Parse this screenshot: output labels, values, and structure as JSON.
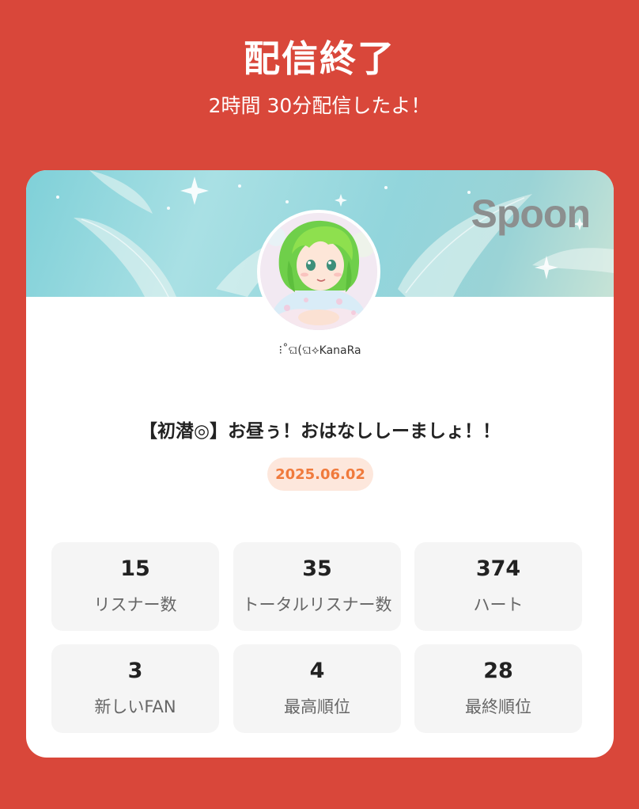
{
  "header": {
    "title": "配信終了",
    "subtitle": "2時間 30分配信したよ！"
  },
  "card": {
    "brand": "Spoon",
    "username_deco": "⁝˚ଘ(ଘ⟡",
    "username": "KanaRa",
    "broadcast_title": "【初潜◎】お昼ぅ！おはなししーましょ！！",
    "date": "2025.06.02",
    "accent_color": "#d9473a",
    "date_color": "#f07a3c"
  },
  "stats": [
    {
      "value": "15",
      "label": "リスナー数"
    },
    {
      "value": "35",
      "label": "トータルリスナー数"
    },
    {
      "value": "374",
      "label": "ハート"
    },
    {
      "value": "3",
      "label": "新しいFAN"
    },
    {
      "value": "4",
      "label": "最高順位"
    },
    {
      "value": "28",
      "label": "最終順位"
    }
  ]
}
